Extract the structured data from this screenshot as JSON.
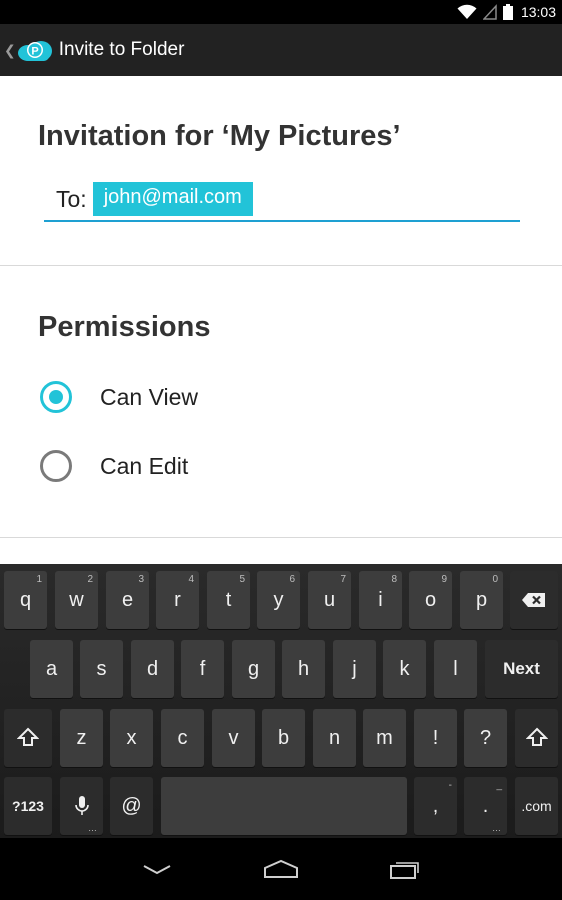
{
  "status_bar": {
    "time": "13:03"
  },
  "action_bar": {
    "title": "Invite to Folder",
    "logo_letter": "P"
  },
  "invitation": {
    "title": "Invitation for ‘My Pictures’",
    "to_label": "To:",
    "recipient": "john@mail.com"
  },
  "permissions": {
    "title": "Permissions",
    "options": [
      {
        "label": "Can View",
        "selected": true
      },
      {
        "label": "Can Edit",
        "selected": false
      }
    ]
  },
  "keyboard": {
    "row1": [
      {
        "label": "q",
        "hint": "1"
      },
      {
        "label": "w",
        "hint": "2"
      },
      {
        "label": "e",
        "hint": "3"
      },
      {
        "label": "r",
        "hint": "4"
      },
      {
        "label": "t",
        "hint": "5"
      },
      {
        "label": "y",
        "hint": "6"
      },
      {
        "label": "u",
        "hint": "7"
      },
      {
        "label": "i",
        "hint": "8"
      },
      {
        "label": "o",
        "hint": "9"
      },
      {
        "label": "p",
        "hint": "0"
      }
    ],
    "row2": [
      "a",
      "s",
      "d",
      "f",
      "g",
      "h",
      "j",
      "k",
      "l"
    ],
    "row2_action": "Next",
    "row3": [
      "z",
      "x",
      "c",
      "v",
      "b",
      "n",
      "m",
      "!",
      "?"
    ],
    "symbols_label": "?123",
    "at_label": "@",
    "comma_label": ",",
    "comma_hint": "-",
    "period_label": ".",
    "period_hint": "_",
    "com_label": ".com"
  },
  "colors": {
    "accent": "#22c3d8",
    "underline": "#1ea0d2",
    "action_bar": "#222222"
  },
  "icons": {
    "wifi": "wifi-icon",
    "signal": "signal-icon",
    "battery": "battery-icon",
    "back": "chevron-left-icon",
    "app_logo": "pcloud-logo-icon",
    "backspace": "backspace-icon",
    "shift": "shift-icon",
    "mic": "microphone-icon",
    "nav_back": "nav-back-icon",
    "nav_home": "nav-home-icon",
    "nav_recents": "nav-recents-icon"
  }
}
